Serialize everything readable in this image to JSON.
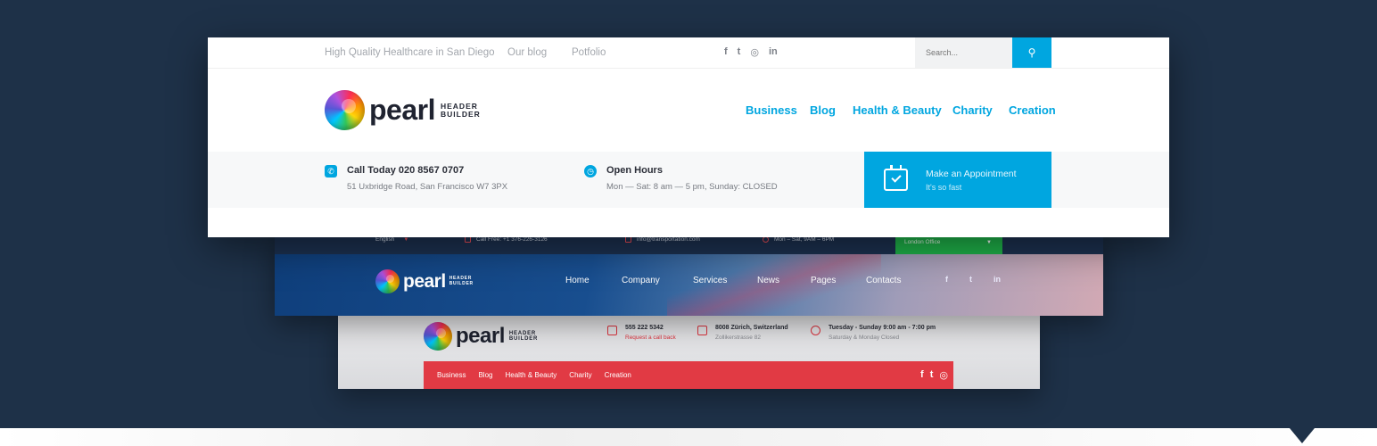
{
  "colors": {
    "background": "#1e3148",
    "accent_blue": "#00a6e0",
    "accent_red": "#e13a44",
    "accent_green": "#1fb34a"
  },
  "header1": {
    "topbar": {
      "tagline": "High Quality Healthcare in San Diego",
      "links": [
        "Our blog",
        "Potfolio"
      ],
      "social_icons": [
        "f",
        "t",
        "◎",
        "in"
      ],
      "search_placeholder": "Search..."
    },
    "logo": {
      "word": "pearl",
      "sub_line1": "HEADER",
      "sub_line2": "BUILDER"
    },
    "nav": [
      "Business",
      "Blog",
      "Health & Beauty",
      "Charity",
      "Creation"
    ],
    "info": [
      {
        "icon": "phone-icon",
        "title": "Call Today 020 8567 0707",
        "subtitle": "51 Uxbridge Road, San Francisco W7 3PX"
      },
      {
        "icon": "clock-icon",
        "title": "Open Hours",
        "subtitle": "Mon — Sat: 8 am — 5 pm, Sunday: CLOSED"
      }
    ],
    "appointment": {
      "title": "Make an Appointment",
      "subtitle": "It's so fast"
    }
  },
  "header2": {
    "topbar": {
      "language": "English",
      "phone": "Call Free: +1 376-226-3126",
      "email": "info@transportation.com",
      "hours": "Mon – Sat, 9AM – 6PM",
      "office": "London Office"
    },
    "logo": {
      "word": "pearl",
      "sub_line1": "HEADER",
      "sub_line2": "BUILDER"
    },
    "nav": [
      "Home",
      "Company",
      "Services",
      "News",
      "Pages",
      "Contacts"
    ],
    "social_icons": [
      "f",
      "t",
      "in"
    ]
  },
  "header3": {
    "logo": {
      "word": "pearl",
      "sub_line1": "HEADER",
      "sub_line2": "BUILDER"
    },
    "info": [
      {
        "title": "555 222 5342",
        "subtitle": "Request a call back"
      },
      {
        "title": "8008 Zürich, Switzerland",
        "subtitle": "Zollikerstrasse 82"
      },
      {
        "title": "Tuesday - Sunday 9:00 am - 7:00 pm",
        "subtitle": "Saturday & Monday Closed"
      }
    ],
    "nav": [
      "Business",
      "Blog",
      "Health & Beauty",
      "Charity",
      "Creation"
    ],
    "social_icons": [
      "f",
      "t",
      "◎"
    ]
  }
}
